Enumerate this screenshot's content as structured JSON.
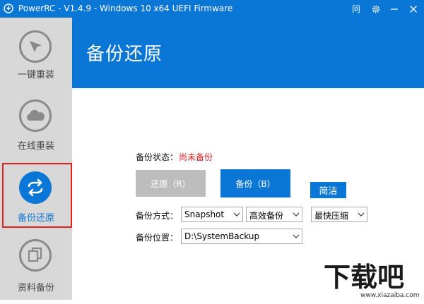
{
  "window": {
    "title": "PowerRC - V1.4.9 - Windows 10 x64 UEFI Firmware",
    "buttons": {
      "feedback_glyph": "冋"
    },
    "icons": [
      "app-logo-icon",
      "feedback-icon",
      "settings-gear-icon",
      "minimize-icon",
      "close-icon"
    ]
  },
  "sidebar": {
    "items": [
      {
        "label": "一键重装",
        "icon": "cursor-arrow-icon",
        "active": false
      },
      {
        "label": "在线重装",
        "icon": "cloud-icon",
        "active": false
      },
      {
        "label": "备份还原",
        "icon": "sync-arrows-icon",
        "active": true
      },
      {
        "label": "资料备份",
        "icon": "copy-files-icon",
        "active": false
      }
    ]
  },
  "header": {
    "title": "备份还原"
  },
  "main": {
    "status_label": "备份状态：",
    "status_value": "尚未备份",
    "restore_button": "还原（R）",
    "backup_button": "备份（B）",
    "simple_button": "简洁",
    "mode_label": "备份方式：",
    "mode_select": "Snapshot",
    "efficiency_select": "高效备份",
    "compress_select": "最快压缩",
    "location_label": "备份位置：",
    "location_select": "D:\\SystemBackup"
  },
  "watermark": {
    "brand": "下载吧",
    "url": "www.xiazaiba.com"
  },
  "colors": {
    "accent": "#0a77d6",
    "sidebar_bg": "#d8d8d8",
    "icon_gray": "#8a8a8a",
    "status_red": "#e02020",
    "disabled_button": "#bdbdbd"
  }
}
